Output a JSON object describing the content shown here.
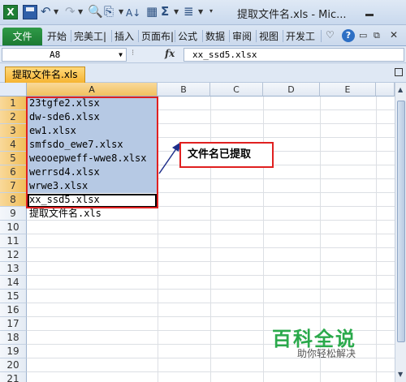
{
  "window": {
    "title": "提取文件名.xls - Mic...",
    "app_icon": "excel-icon",
    "quick_access": [
      "save-icon",
      "undo-icon",
      "redo-icon",
      "print-preview-icon",
      "format-painter-icon",
      "sort-icon",
      "borders-icon",
      "autosum-icon",
      "align-icon"
    ]
  },
  "ribbon": {
    "file_tab": "文件",
    "tabs": [
      "开始",
      "完美工|",
      "插入",
      "页面布|",
      "公式",
      "数据",
      "审阅",
      "视图",
      "开发工"
    ],
    "help_label": "?"
  },
  "formula_bar": {
    "name_box": "A8",
    "fx_label": "fx",
    "formula": "xx_ssd5.xlsx"
  },
  "workbook_tab": "提取文件名.xls",
  "grid": {
    "columns": [
      "A",
      "B",
      "C",
      "D",
      "E"
    ],
    "rows": [
      "1",
      "2",
      "3",
      "4",
      "5",
      "6",
      "7",
      "8",
      "9",
      "10",
      "11",
      "12",
      "13",
      "14",
      "15",
      "16",
      "17",
      "18",
      "19",
      "20",
      "21"
    ],
    "cells_A": [
      "23tgfe2.xlsx",
      "dw-sde6.xlsx",
      "ew1.xlsx",
      "smfsdo_ewe7.xlsx",
      "weooepweff-wwe8.xlsx",
      "werrsd4.xlsx",
      "wrwe3.xlsx",
      "xx_ssd5.xlsx",
      "提取文件名.xls"
    ],
    "selected_column": "A",
    "selected_rows": [
      "1",
      "2",
      "3",
      "4",
      "5",
      "6",
      "7",
      "8"
    ]
  },
  "callout": {
    "text": "文件名已提取",
    "border_color": "#e02020"
  },
  "watermark": {
    "title": "百科全说",
    "subtitle": "助你轻松解决",
    "color": "#2aa94b"
  },
  "colors": {
    "selection_fill": "#b6c9e4",
    "header_highlight": "#f1c15f",
    "file_tab": "#1c7a33"
  }
}
